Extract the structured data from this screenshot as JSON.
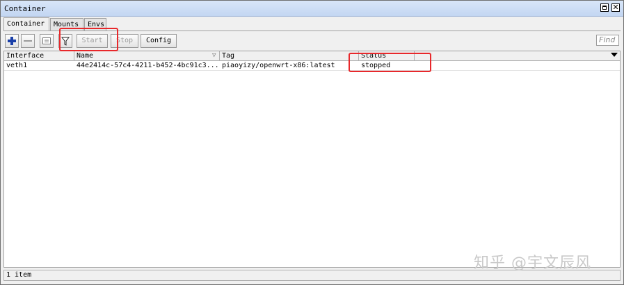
{
  "window": {
    "title": "Container"
  },
  "tabs": [
    {
      "label": "Container",
      "active": true
    },
    {
      "label": "Mounts",
      "active": false
    },
    {
      "label": "Envs",
      "active": false
    }
  ],
  "toolbar": {
    "add_icon": "plus-icon",
    "remove_icon": "minus-icon",
    "comment_icon": "comment-icon",
    "filter_icon": "filter-icon",
    "start_label": "Start",
    "stop_label": "Stop",
    "config_label": "Config",
    "find_placeholder": "Find"
  },
  "table": {
    "columns": [
      "Interface",
      "Name",
      "Tag",
      "Status"
    ],
    "rows": [
      {
        "interface": "veth1",
        "name": "44e2414c-57c4-4211-b452-4bc91c3...",
        "tag": "piaoyizy/openwrt-x86:latest",
        "status": "stopped"
      }
    ]
  },
  "status_bar": {
    "text": "1 item"
  },
  "watermark": {
    "text": "知乎 @宇文辰风"
  },
  "colors": {
    "highlight": "#e8282b",
    "titlebar": "#c3d6f2",
    "add_icon": "#1a3fa8"
  }
}
